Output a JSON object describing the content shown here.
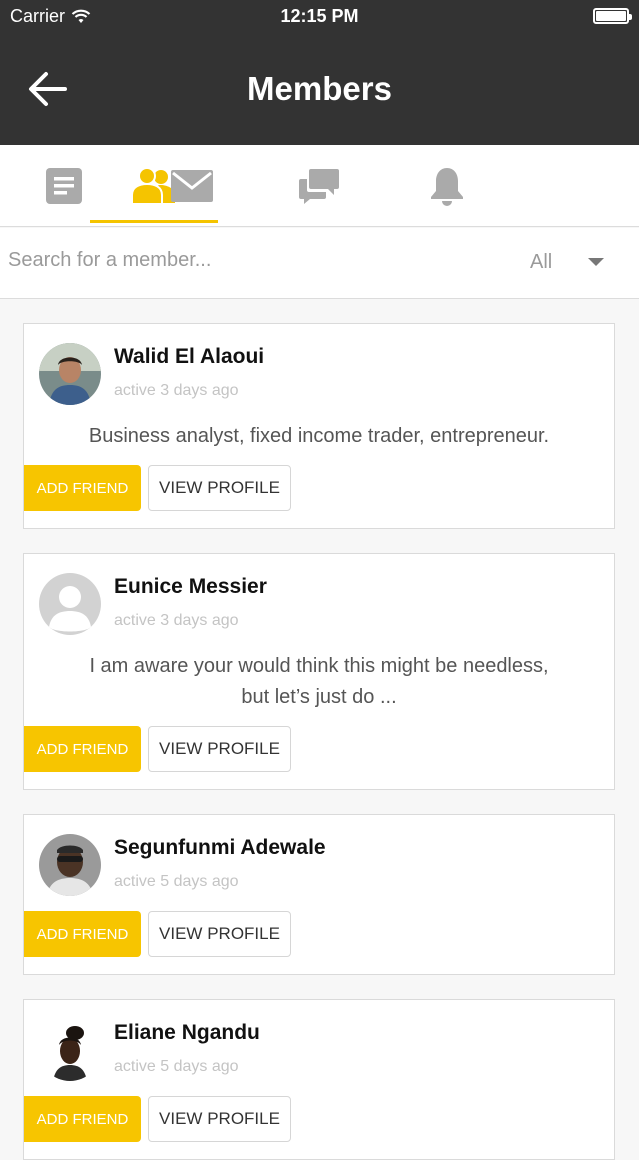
{
  "status_bar": {
    "carrier": "Carrier",
    "time": "12:15 PM"
  },
  "header": {
    "title": "Members",
    "back_icon": "back-arrow-icon"
  },
  "tabs": [
    {
      "icon": "activity-icon",
      "active": false
    },
    {
      "icon": "members-icon",
      "active": true
    },
    {
      "icon": "mail-icon",
      "active": false
    },
    {
      "icon": "chat-icon",
      "active": false
    },
    {
      "icon": "bell-icon",
      "active": false
    }
  ],
  "search": {
    "placeholder": "Search for a member...",
    "value": "",
    "filter_value": "All"
  },
  "colors": {
    "topbar": "#333333",
    "accent": "#f7c500",
    "muted": "#c4c4c4"
  },
  "members": [
    {
      "name": "Walid El Alaoui",
      "active": "active 3 days ago",
      "bio_line1": "Business analyst, fixed income trader, entrepreneur.",
      "bio_line2": "",
      "add_label": "ADD FRIEND",
      "view_label": "VIEW PROFILE",
      "avatar": "photo-avatar"
    },
    {
      "name": "Eunice Messier",
      "active": "active 3 days ago",
      "bio_line1": "I am aware your would think this might be needless,",
      "bio_line2": "but let’s just do ...",
      "add_label": "ADD FRIEND",
      "view_label": "VIEW PROFILE",
      "avatar": "default-avatar"
    },
    {
      "name": "Segunfunmi Adewale",
      "active": "active 5 days ago",
      "bio_line1": "",
      "bio_line2": "",
      "add_label": "ADD FRIEND",
      "view_label": "VIEW PROFILE",
      "avatar": "photo-avatar"
    },
    {
      "name": "Eliane Ngandu",
      "active": "active 5 days ago",
      "bio_line1": "",
      "bio_line2": "",
      "add_label": "ADD FRIEND",
      "view_label": "VIEW PROFILE",
      "avatar": "photo-avatar"
    }
  ]
}
